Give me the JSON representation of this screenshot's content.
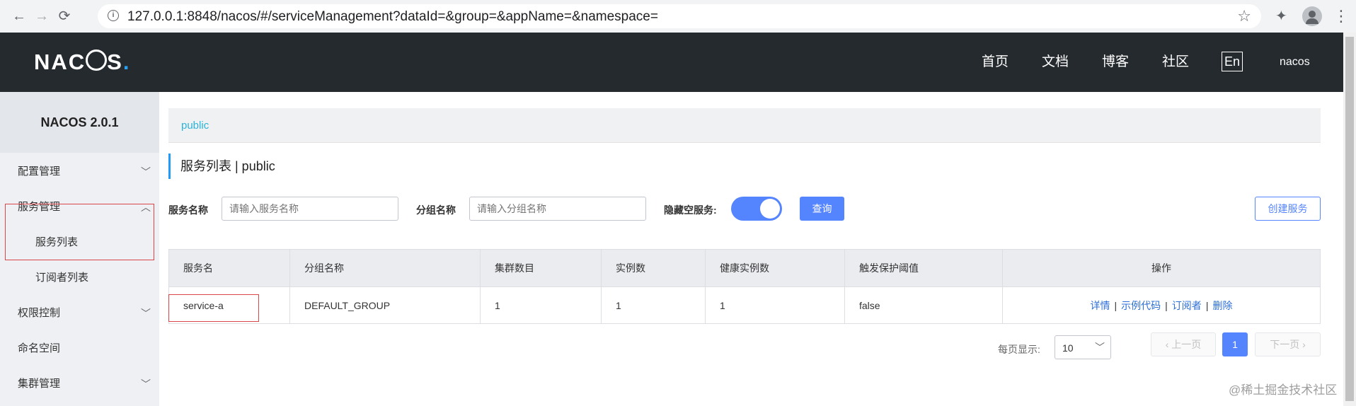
{
  "browser": {
    "back": "←",
    "forward": "→",
    "reload": "⟳",
    "url": "127.0.0.1:8848/nacos/#/serviceManagement?dataId=&group=&appName=&namespace="
  },
  "header": {
    "logo_left": "NAC",
    "logo_right": "S",
    "logo_dot": ".",
    "nav": [
      "首页",
      "文档",
      "博客",
      "社区"
    ],
    "lang": "En",
    "user": "nacos"
  },
  "sidebar": {
    "title": "NACOS 2.0.1",
    "items": [
      {
        "label": "配置管理"
      },
      {
        "label": "服务管理"
      },
      {
        "label": "服务列表"
      },
      {
        "label": "订阅者列表"
      },
      {
        "label": "权限控制"
      },
      {
        "label": "命名空间"
      },
      {
        "label": "集群管理"
      }
    ]
  },
  "namespace_bar": "public",
  "page_title": "服务列表  |  public",
  "filters": {
    "service_name_label": "服务名称",
    "service_name_placeholder": "请输入服务名称",
    "group_label": "分组名称",
    "group_placeholder": "请输入分组名称",
    "hide_empty_label": "隐藏空服务:",
    "hide_empty_on": true,
    "query_button": "查询",
    "create_button": "创建服务"
  },
  "table": {
    "headers": [
      "服务名",
      "分组名称",
      "集群数目",
      "实例数",
      "健康实例数",
      "触发保护阈值",
      "操作"
    ],
    "rows": [
      {
        "service": "service-a",
        "group": "DEFAULT_GROUP",
        "clusters": "1",
        "instances": "1",
        "healthy": "1",
        "threshold": "false",
        "ops": [
          "详情",
          "示例代码",
          "订阅者",
          "删除"
        ]
      }
    ]
  },
  "pagination": {
    "page_size_label": "每页显示:",
    "page_size": "10",
    "prev": "上一页",
    "current": "1",
    "next": "下一页"
  },
  "watermark": "@稀土掘金技术社区",
  "colors": {
    "header_bg": "#252a2f",
    "primary": "#5584ff",
    "link": "#2c6fd6",
    "highlight_box": "#d9474a"
  }
}
